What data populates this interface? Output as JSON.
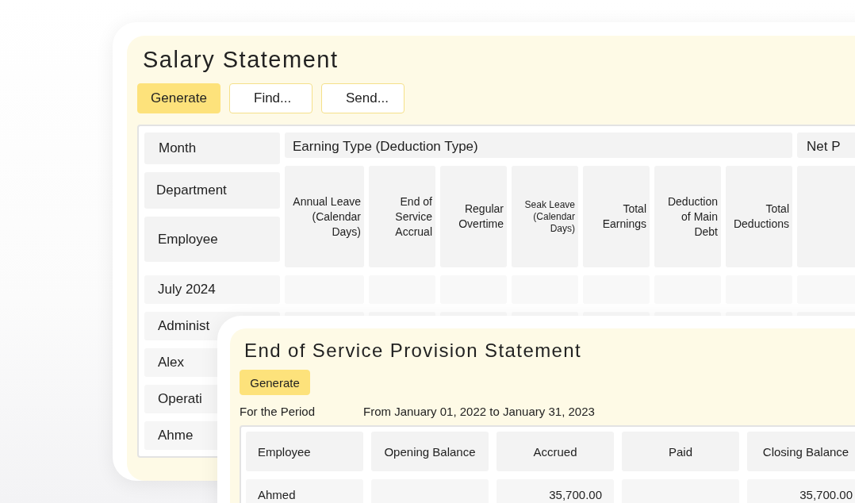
{
  "salary_statement": {
    "title": "Salary Statement",
    "buttons": [
      {
        "label": "Generate",
        "kind": "primary"
      },
      {
        "label": "Find...",
        "kind": "outline"
      },
      {
        "label": "Send...",
        "kind": "outline"
      }
    ],
    "table": {
      "row_headers": [
        "Month",
        "Department",
        "Employee"
      ],
      "group_header": "Earning Type (Deduction Type)",
      "column_2_header": "Net P",
      "columns": [
        "Annual Leave (Calendar Days)",
        "End of Service Accrual",
        "Regular Overtime",
        "Seak Leave (Calendar Days)",
        "Total Earnings",
        "Deduction of Main Debt",
        "Total Deductions"
      ],
      "rows": [
        {
          "label": "July 2024"
        },
        {
          "label": "Administ"
        },
        {
          "label": "Alex"
        },
        {
          "label": "Operati"
        },
        {
          "label": "Ahme"
        }
      ]
    }
  },
  "end_of_service": {
    "title": "End of Service Provision Statement",
    "buttons": [
      {
        "label": "Generate",
        "kind": "primary"
      }
    ],
    "period_label": "For the Period",
    "period_value": "From January 01, 2022 to January 31, 2023",
    "table": {
      "columns": [
        "Employee",
        "Opening Balance",
        "Accrued",
        "Paid",
        "Closing Balance"
      ],
      "rows": [
        {
          "cells": [
            "Ahmed",
            "",
            "35,700.00",
            "",
            "35,700.00"
          ]
        }
      ]
    }
  }
}
